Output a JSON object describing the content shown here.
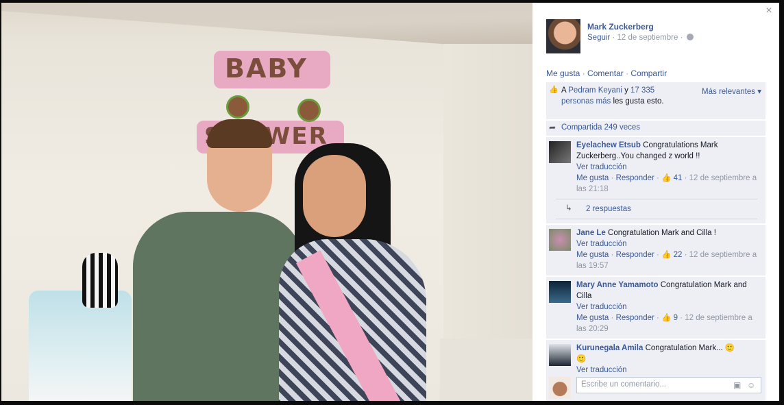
{
  "photo": {
    "description_banner_top": "BABY",
    "description_banner_bottom": "SHOWER"
  },
  "close": {
    "icon": "close-icon",
    "glyph": "×"
  },
  "post": {
    "author": "Mark Zuckerberg",
    "follow": "Seguir",
    "date": "12 de septiembre",
    "sep": "·"
  },
  "actions": {
    "like": "Me gusta",
    "comment": "Comentar",
    "share": "Compartir"
  },
  "likes": {
    "prefix": "A",
    "person": "Pedram Keyani",
    "and": "y",
    "others": "17 335 personas más",
    "suffix": "les gusta esto.",
    "sort": "Más relevantes"
  },
  "shares": {
    "text": "Compartida 249 veces"
  },
  "comments": [
    {
      "name": "Eyelachew Etsub",
      "text": "Congratulations Mark Zuckerberg..You changed z world !!",
      "translate": "Ver traducción",
      "like": "Me gusta",
      "reply": "Responder",
      "likes": "41",
      "time": "12 de septiembre a las 21:18",
      "replies": "2 respuestas"
    },
    {
      "name": "Jane Le",
      "text": "Congratulation Mark and Cilla !",
      "translate": "Ver traducción",
      "like": "Me gusta",
      "reply": "Responder",
      "likes": "22",
      "time": "12 de septiembre a las 19:57"
    },
    {
      "name": "Mary Anne Yamamoto",
      "text": "Congratulation Mark and Cilla",
      "translate": "Ver traducción",
      "like": "Me gusta",
      "reply": "Responder",
      "likes": "9",
      "time": "12 de septiembre a las 20:29"
    },
    {
      "name": "Kurunegala Amila",
      "text": "Congratulation Mark...",
      "translate": "Ver traducción"
    }
  ],
  "compose": {
    "placeholder": "Escribe un comentario..."
  }
}
